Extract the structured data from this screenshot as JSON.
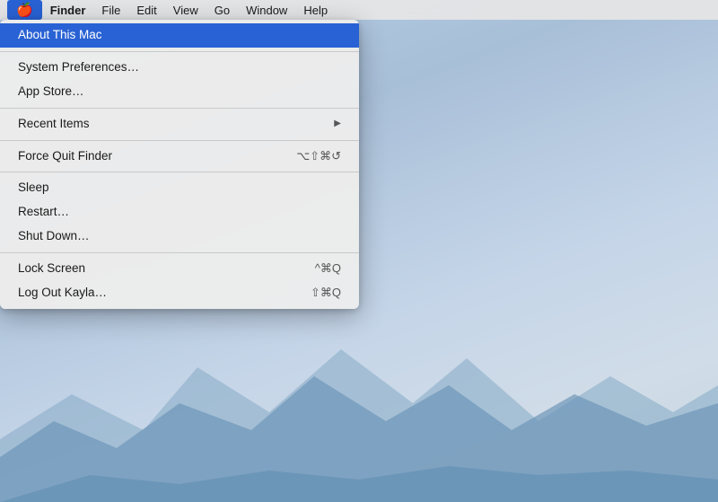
{
  "menubar": {
    "apple_icon": "🍎",
    "items": [
      {
        "label": "Finder",
        "bold": true
      },
      {
        "label": "File"
      },
      {
        "label": "Edit"
      },
      {
        "label": "View"
      },
      {
        "label": "Go"
      },
      {
        "label": "Window"
      },
      {
        "label": "Help"
      }
    ]
  },
  "dropdown": {
    "items": [
      {
        "type": "item",
        "label": "About This Mac",
        "shortcut": "",
        "arrow": false,
        "highlighted": true,
        "id": "about-this-mac"
      },
      {
        "type": "separator"
      },
      {
        "type": "item",
        "label": "System Preferences…",
        "shortcut": "",
        "arrow": false,
        "highlighted": false,
        "id": "system-preferences"
      },
      {
        "type": "item",
        "label": "App Store…",
        "shortcut": "",
        "arrow": false,
        "highlighted": false,
        "id": "app-store"
      },
      {
        "type": "separator"
      },
      {
        "type": "item",
        "label": "Recent Items",
        "shortcut": "",
        "arrow": true,
        "highlighted": false,
        "id": "recent-items"
      },
      {
        "type": "separator"
      },
      {
        "type": "item",
        "label": "Force Quit Finder",
        "shortcut": "⌥⇧⌘↺",
        "arrow": false,
        "highlighted": false,
        "id": "force-quit"
      },
      {
        "type": "separator"
      },
      {
        "type": "item",
        "label": "Sleep",
        "shortcut": "",
        "arrow": false,
        "highlighted": false,
        "id": "sleep"
      },
      {
        "type": "item",
        "label": "Restart…",
        "shortcut": "",
        "arrow": false,
        "highlighted": false,
        "id": "restart"
      },
      {
        "type": "item",
        "label": "Shut Down…",
        "shortcut": "",
        "arrow": false,
        "highlighted": false,
        "id": "shut-down"
      },
      {
        "type": "separator"
      },
      {
        "type": "item",
        "label": "Lock Screen",
        "shortcut": "^⌘Q",
        "arrow": false,
        "highlighted": false,
        "id": "lock-screen"
      },
      {
        "type": "item",
        "label": "Log Out Kayla…",
        "shortcut": "⇧⌘Q",
        "arrow": false,
        "highlighted": false,
        "id": "log-out"
      }
    ]
  }
}
